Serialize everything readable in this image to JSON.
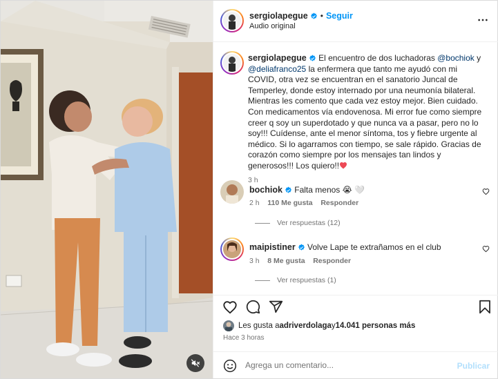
{
  "post": {
    "author": "sergiolapegue",
    "follow_label": "Seguir",
    "separator": "•",
    "audio_label": "Audio original",
    "more_icon": "more-horizontal-icon"
  },
  "caption": {
    "username": "sergiolapegue",
    "segments": [
      {
        "text": "El encuentro de dos luchadoras ",
        "mention": false
      },
      {
        "text": "@bochiok",
        "mention": true
      },
      {
        "text": " y ",
        "mention": false
      },
      {
        "text": "@deliafranco25",
        "mention": true
      },
      {
        "text": " la enfermera que tanto me ayudó con mi COVID, otra vez se encuentran en el sanatorio Juncal de Temperley, donde estoy internado por una neumonía bilateral. Mientras les comento que cada vez estoy mejor. Bien cuidado. Con medicamentos vía endovenosa. Mi error fue como siempre creer q soy un superdotado y que nunca va a pasar, pero no lo soy!!! Cuídense, ante el menor síntoma, tos y fiebre urgente al médico. Si lo agarramos con tiempo, se sale rápido. Gracias de corazón como siempre por los mensajes tan lindos y generosos!!! Los quiero!!",
        "mention": false
      }
    ],
    "emoji": "❤️",
    "time": "3 h"
  },
  "comments": [
    {
      "username": "bochiok",
      "text": "Falta menos ",
      "emojis": "😭 🤍",
      "time": "2 h",
      "likes": "110 Me gusta",
      "reply_label": "Responder",
      "view_replies": "Ver respuestas (12)"
    },
    {
      "username": "maipistiner",
      "text": "Volve Lape te extrañamos en el club",
      "emojis": "",
      "time": "3 h",
      "likes": "8 Me gusta",
      "reply_label": "Responder",
      "view_replies": "Ver respuestas (1)"
    }
  ],
  "likes": {
    "prefix": "Les gusta a ",
    "user": "adriverdolaga",
    "middle": " y ",
    "count": "14.041 personas más"
  },
  "timeago": "Hace 3 horas",
  "comment_box": {
    "placeholder": "Agrega un comentario...",
    "publish_label": "Publicar"
  },
  "colors": {
    "link_blue": "#0095f6",
    "mention": "#00376b",
    "verified": "#0095f6",
    "heart_red": "#ed4956",
    "publish_disabled": "#b2dffc"
  }
}
